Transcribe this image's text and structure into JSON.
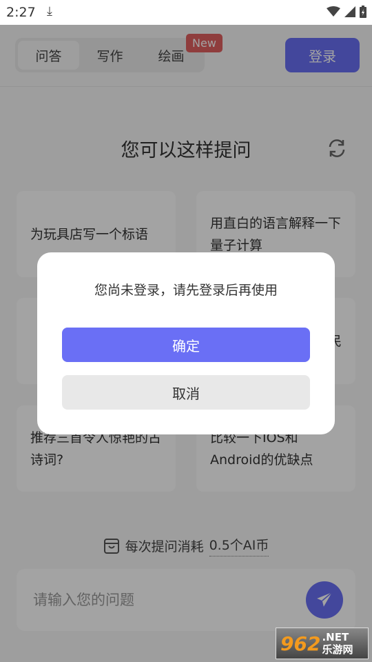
{
  "status_bar": {
    "time": "2:27"
  },
  "header": {
    "tabs": [
      {
        "label": "问答",
        "active": true
      },
      {
        "label": "写作"
      },
      {
        "label": "绘画"
      }
    ],
    "new_badge": "New",
    "login_label": "登录"
  },
  "main": {
    "title": "您可以这样提问",
    "cards": [
      {
        "text": "为玩具店写一个标语"
      },
      {
        "text": "用直白的语言解释一下量子计算"
      },
      {
        "text": ""
      },
      {
        "text": "民"
      },
      {
        "text": "推荐三首令人惊艳的古诗词?"
      },
      {
        "text": "比较一下IOS和Android的优缺点"
      }
    ],
    "cost_prefix": "每次提问消耗",
    "cost_amount": "0.5个AI币",
    "input_placeholder": "请输入您的问题"
  },
  "dialog": {
    "message": "您尚未登录，请先登录后再使用",
    "confirm_label": "确定",
    "cancel_label": "取消"
  },
  "watermark": {
    "number": "962",
    "suffix": ".NET",
    "cn": "乐游网"
  },
  "colors": {
    "accent": "#6a6ff5",
    "badge": "#e06060",
    "overlay": "rgba(0,0,0,0.36)"
  }
}
